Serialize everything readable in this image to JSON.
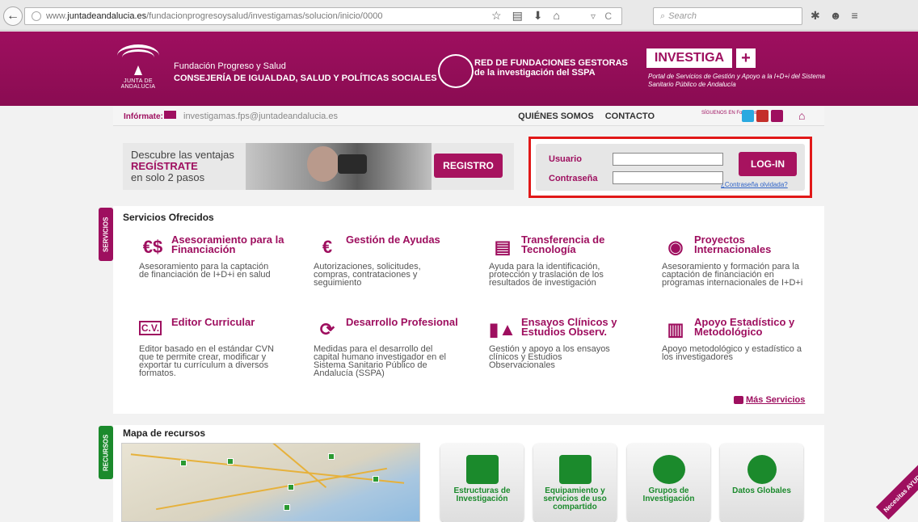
{
  "browser": {
    "url_prefix": "www.",
    "url_domain": "juntadeandalucia.es",
    "url_path": "/fundacionprogresoysalud/investigamas/solucion/inicio/0000",
    "search_placeholder": "Search"
  },
  "header": {
    "junta_label": "JUNTA DE ANDALUCIA",
    "org_line1": "Fundación Progreso y Salud",
    "org_line2": "CONSEJERÍA DE IGUALDAD, SALUD Y POLÍTICAS SOCIALES",
    "red_line1": "RED DE FUNDACIONES GESTORAS",
    "red_line2": "de la investigación del SSPA",
    "investiga": "INVESTIGA",
    "plus": "+",
    "portal_text": "Portal de Servicios de Gestión y Apoyo a la I+D+i del Sistema Sanitario Público de Andalucía"
  },
  "navbar": {
    "informate": "Infórmate:",
    "email": "investigamas.fps@juntadeandalucia.es",
    "quienes": "QUIÉNES SOMOS",
    "contacto": "CONTACTO",
    "follow": "SÍGUENOS EN Follow us"
  },
  "banner": {
    "line1": "Descubre las ventajas",
    "line2": "REGÍSTRATE",
    "line3": "en solo 2 pasos",
    "register_button": "REGISTRO"
  },
  "login": {
    "user_label": "Usuario",
    "password_label": "Contraseña",
    "button": "LOG-IN",
    "forgot": "¿Contraseña olvidada?"
  },
  "services": {
    "tab": "SERVICIOS",
    "title": "Servicios Ofrecidos",
    "items": [
      {
        "title": "Asesoramiento para la Financiación",
        "desc": "Asesoramiento para la captación de financiación de I+D+i en salud",
        "icon": "money-icon"
      },
      {
        "title": "Gestión de Ayudas",
        "desc": "Autorizaciones, solicitudes, compras, contrataciones y seguimiento",
        "icon": "cart-icon"
      },
      {
        "title": "Transferencia de Tecnología",
        "desc": "Ayuda para la identificación, protección y traslación de los resultados de investigación",
        "icon": "document-icon"
      },
      {
        "title": "Proyectos Internacionales",
        "desc": "Asesoramiento y formación para la captación de financiación en programas internacionales de I+D+i",
        "icon": "globe-icon"
      },
      {
        "title": "Editor Curricular",
        "desc": "Editor basado en el estándar CVN que te permite crear, modificar y exportar tu currículum a diversos formatos.",
        "icon": "cv-icon"
      },
      {
        "title": "Desarrollo Profesional",
        "desc": "Medidas para el desarrollo del capital humano investigador en el Sistema Sanitario Público de Andalucía (SSPA)",
        "icon": "cycle-icon"
      },
      {
        "title": "Ensayos Clínicos y Estudios Observ.",
        "desc": "Gestión y apoyo a los ensayos clínicos y Estudios Observacionales",
        "icon": "flask-icon"
      },
      {
        "title": "Apoyo Estadístico y Metodológico",
        "desc": "Apoyo metodológico y estadístico a los investigadores",
        "icon": "stats-icon"
      }
    ],
    "more": "Más Servicios"
  },
  "resources": {
    "tab": "RECURSOS",
    "title": "Mapa de recursos",
    "tiles": [
      {
        "label": "Estructuras de Investigación"
      },
      {
        "label": "Equipamiento y servicios de uso compartido"
      },
      {
        "label": "Grupos de Investigación"
      },
      {
        "label": "Datos Globales"
      }
    ]
  },
  "help": "Necesitas AYUDA?",
  "colors": {
    "brand": "#9e0f5f",
    "green": "#1b8a2c",
    "highlight": "#e11818"
  }
}
